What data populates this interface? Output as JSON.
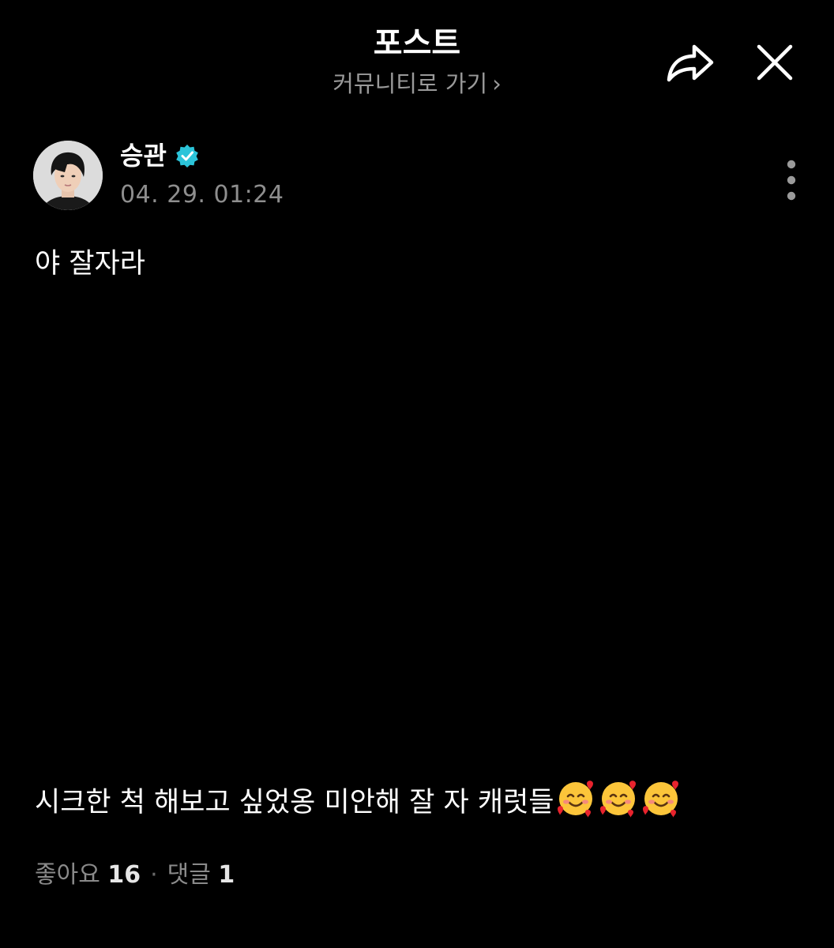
{
  "header": {
    "title": "포스트",
    "subtitle": "커뮤니티로 가기",
    "subtitle_chevron": "›",
    "share_icon": "share-arrow-icon",
    "close_icon": "close-icon"
  },
  "author": {
    "name": "승관",
    "verified_icon": "verified-badge-icon",
    "verified_color": "#2bc4d9",
    "timestamp": "04. 29. 01:24",
    "more_icon": "more-vertical-icon"
  },
  "post": {
    "title": "야 잘자라",
    "body_text": "시크한 척 해보고 싶었옹 미안해 잘 자 캐럿들",
    "body_emojis": [
      "smiling-face-with-hearts-emoji",
      "smiling-face-with-hearts-emoji",
      "smiling-face-with-hearts-emoji"
    ]
  },
  "stats": {
    "likes_label": "좋아요",
    "likes_count": "16",
    "separator": "·",
    "comments_label": "댓글",
    "comments_count": "1"
  }
}
